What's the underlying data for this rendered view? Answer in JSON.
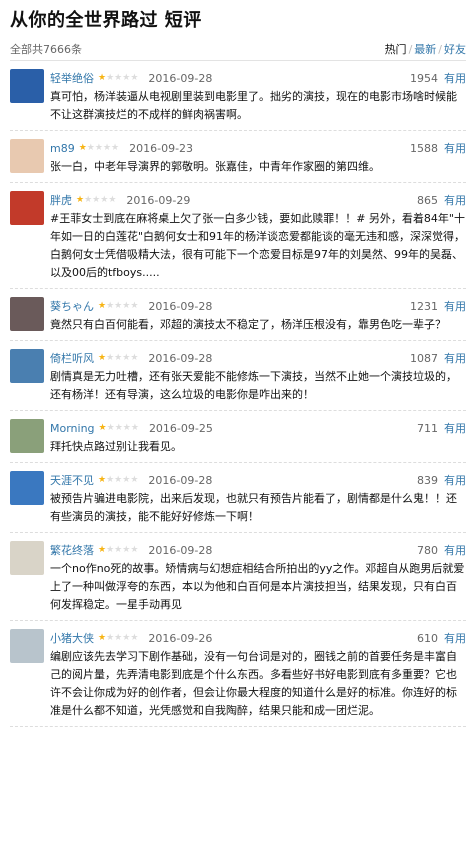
{
  "header": {
    "title": "从你的全世界路过 短评",
    "total": "全部共7666条",
    "filters": [
      "热门",
      "最新",
      "好友"
    ]
  },
  "reviews": [
    {
      "user": "轻举绝俗",
      "stars": 1,
      "date": "2016-09-28",
      "votes": "1954",
      "useful": "有用",
      "text": "真可怕，杨洋装逼从电视剧里装到电影里了。拙劣的演技，现在的电影市场啥时候能不让这群演技烂的不成样的鲜肉祸害啊。",
      "avatar_color": "#2a5fa8"
    },
    {
      "user": "m89",
      "stars": 1,
      "date": "2016-09-23",
      "votes": "1588",
      "useful": "有用",
      "text": "张一白，中老年导演界的郭敬明。张嘉佳，中青年作家圈的第四维。",
      "avatar_color": "#e8c9b0"
    },
    {
      "user": "胖虎",
      "stars": 1,
      "date": "2016-09-29",
      "votes": "865",
      "useful": "有用",
      "text": "#王菲女士到底在麻将桌上欠了张一白多少钱，要如此赎罪！！# 另外，看着84年\"十年如一日的白莲花\"白鹅何女士和91年的杨洋谈恋爱都能谈的毫无违和感，深深觉得，白鹅何女士凭借吸精大法，很有可能下一个恋爱目标是97年的刘昊然、99年的吴磊、以及00后的tfboys.....",
      "avatar_color": "#c23a2a"
    },
    {
      "user": "葵ちゃん",
      "stars": 1,
      "date": "2016-09-28",
      "votes": "1231",
      "useful": "有用",
      "text": "竟然只有白百何能看，邓超的演技太不稳定了，杨洋压根没有，靠男色吃一辈子？",
      "avatar_color": "#6a5a5a"
    },
    {
      "user": "倚栏听风",
      "stars": 1,
      "date": "2016-09-28",
      "votes": "1087",
      "useful": "有用",
      "text": "剧情真是无力吐槽，还有张天爱能不能修炼一下演技，当然不止她一个演技垃圾的，还有杨洋！还有导演，这么垃圾的电影你是咋出来的！",
      "avatar_color": "#4a7fb0"
    },
    {
      "user": "Morning",
      "stars": 1,
      "date": "2016-09-25",
      "votes": "711",
      "useful": "有用",
      "text": "拜托快点路过别让我看见。",
      "avatar_color": "#8aa07a"
    },
    {
      "user": "天涯不见",
      "stars": 1,
      "date": "2016-09-28",
      "votes": "839",
      "useful": "有用",
      "text": "被预告片骗进电影院，出来后发现，也就只有预告片能看了，剧情都是什么鬼！！还有些演员的演技，能不能好好修炼一下啊！",
      "avatar_color": "#3a78c0"
    },
    {
      "user": "繁花终落",
      "stars": 1,
      "date": "2016-09-28",
      "votes": "780",
      "useful": "有用",
      "text": "一个no作no死的故事。矫情病与幻想症相结合所拍出的yy之作。邓超自从跑男后就爱上了一种叫做浮夸的东西，本以为他和白百何是本片演技担当，结果发现，只有白百何发挥稳定。一星手动再见",
      "avatar_color": "#d9d4c8"
    },
    {
      "user": "小猪大侠",
      "stars": 1,
      "date": "2016-09-26",
      "votes": "610",
      "useful": "有用",
      "text": "编剧应该先去学习下剧作基础，没有一句台词是对的，圈钱之前的首要任务是丰富自己的阅片量，先弄清电影到底是个什么东西。多看些好书好电影到底有多重要？它也许不会让你成为好的创作者，但会让你最大程度的知道什么是好的标准。你连好的标准是什么都不知道，光凭感觉和自我陶醉，结果只能和成一团烂泥。",
      "avatar_color": "#b8c4cc"
    }
  ]
}
